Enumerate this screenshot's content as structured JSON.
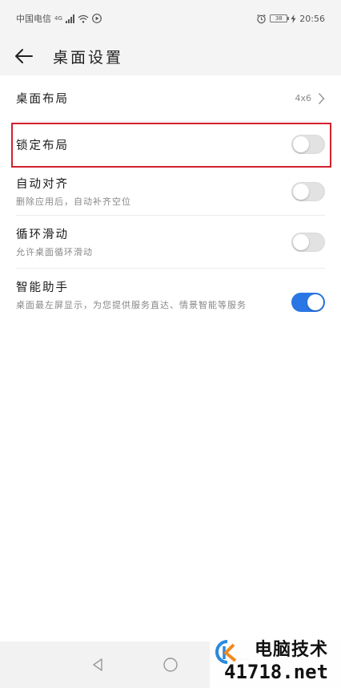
{
  "status": {
    "carrier": "中国电信",
    "signal_tag": "4G",
    "battery": "38",
    "time": "20:56"
  },
  "header": {
    "title": "桌面设置"
  },
  "settings": [
    {
      "title": "桌面布局",
      "value": "4x6"
    },
    {
      "title": "锁定布局",
      "enabled": false
    },
    {
      "title": "自动对齐",
      "desc": "删除应用后，自动补齐空位",
      "enabled": false
    },
    {
      "title": "循环滑动",
      "desc": "允许桌面循环滑动",
      "enabled": false
    },
    {
      "title": "智能助手",
      "desc": "桌面最左屏显示，为您提供服务直达、情景智能等服务",
      "enabled": true
    }
  ],
  "colors": {
    "accent": "#2a76e5",
    "highlight": "#d3202c"
  },
  "watermark": {
    "name": "电脑技术",
    "url": "41718.net"
  }
}
